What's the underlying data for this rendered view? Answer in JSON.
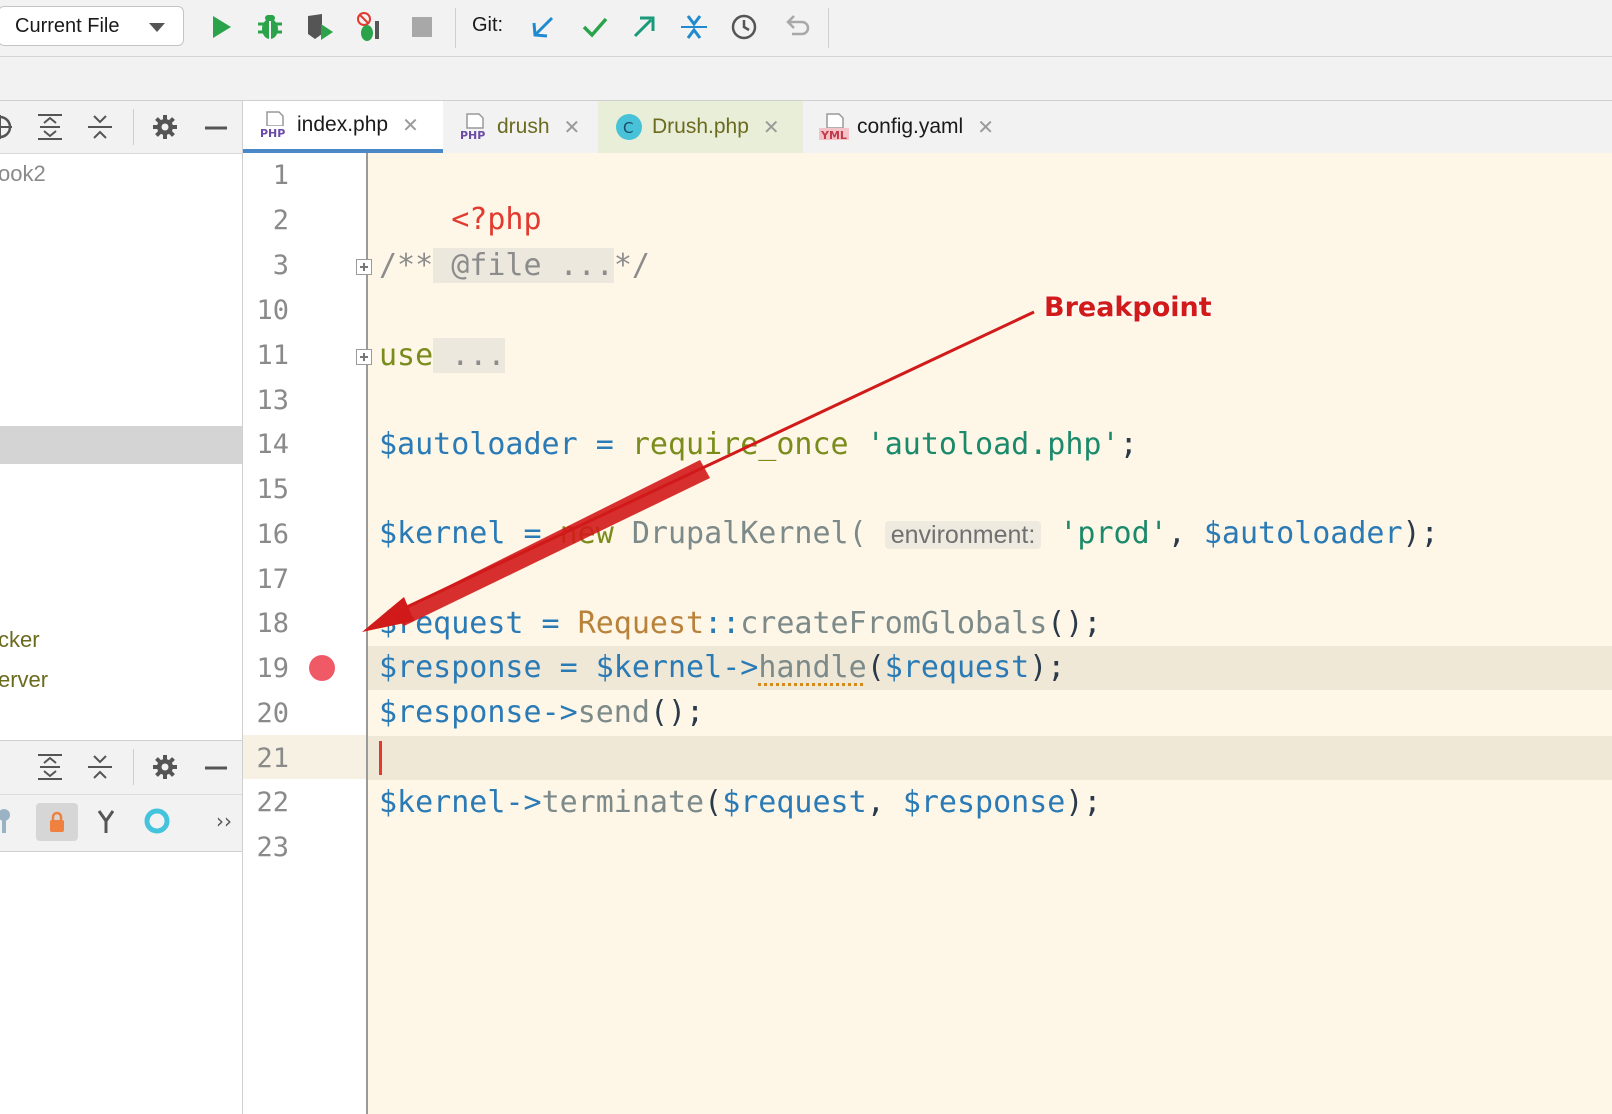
{
  "toolbar": {
    "run_config": "Current File",
    "git_label": "Git:"
  },
  "left_panel": {
    "tree_items": [
      "ook2",
      "cker",
      "erver"
    ]
  },
  "tabs": [
    {
      "label": "index.php",
      "icon": "php-file-icon"
    },
    {
      "label": "drush",
      "icon": "php-file-icon"
    },
    {
      "label": "Drush.php",
      "icon": "class-icon"
    },
    {
      "label": "config.yaml",
      "icon": "yaml-file-icon"
    }
  ],
  "editor": {
    "line_numbers": [
      "1",
      "2",
      "3",
      "10",
      "11",
      "13",
      "14",
      "15",
      "16",
      "17",
      "18",
      "19",
      "20",
      "21",
      "22",
      "23"
    ],
    "code": {
      "l1": "<?php",
      "l3_open": "/**",
      "l3_fold": " @file ...",
      "l3_close": "*/",
      "l11_kw": "use",
      "l11_fold": " ...",
      "l14_var": "$autoloader",
      "l14_op": " = ",
      "l14_kw": "require_once",
      "l14_str": " 'autoload.php'",
      "l14_end": ";",
      "l16_var": "$kernel",
      "l16_op": " = ",
      "l16_kw": "new",
      "l16_cls": " DrupalKernel(",
      "l16_hint": "environment:",
      "l16_str": "'prod'",
      "l16_sep": ", ",
      "l16_var2": "$autoloader",
      "l16_end": ");",
      "l18_var": "$request",
      "l18_op": " = ",
      "l18_cls": "Request",
      "l18_sep": "::",
      "l18_fn": "createFromGlobals",
      "l18_end": "();",
      "l19_var": "$response",
      "l19_op": " = ",
      "l19_var2": "$kernel",
      "l19_arrow": "->",
      "l19_fn": "handle",
      "l19_open": "(",
      "l19_arg": "$request",
      "l19_end": ");",
      "l20_var": "$response",
      "l20_arrow": "->",
      "l20_fn": "send",
      "l20_end": "();",
      "l22_var": "$kernel",
      "l22_arrow": "->",
      "l22_fn": "terminate",
      "l22_open": "(",
      "l22_arg1": "$request",
      "l22_sep": ", ",
      "l22_arg2": "$response",
      "l22_end": ");"
    }
  },
  "annotation": {
    "label": "Breakpoint",
    "color": "#d11a1a"
  }
}
